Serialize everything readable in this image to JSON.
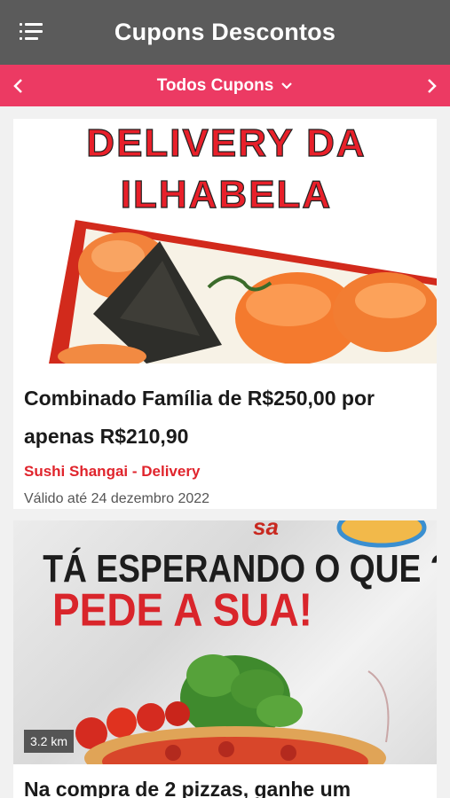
{
  "header": {
    "title": "Cupons Descontos",
    "menu_icon": "menu-icon"
  },
  "filter": {
    "label": "Todos Cupons",
    "prev_icon": "chevron-left-icon",
    "next_icon": "chevron-right-icon",
    "dropdown_icon": "chevron-down-icon"
  },
  "colors": {
    "app_bar": "#5b5b5b",
    "filter_bar": "#ec3a63",
    "store_red": "#e0242c"
  },
  "coupons": [
    {
      "banner_line1": "DELIVERY DA",
      "banner_line2": "ILHABELA",
      "title": "Combinado Família de R$250,00 por apenas R$210,90",
      "store": "Sushi Shangai - Delivery",
      "valid": "Válido até 24 dezembro 2022"
    },
    {
      "banner_line1": "TÁ ESPERANDO O QUE ?",
      "banner_line2": "PEDE A SUA!",
      "distance": "3.2 km",
      "title": "Na compra de 2 pizzas, ganhe um"
    }
  ]
}
